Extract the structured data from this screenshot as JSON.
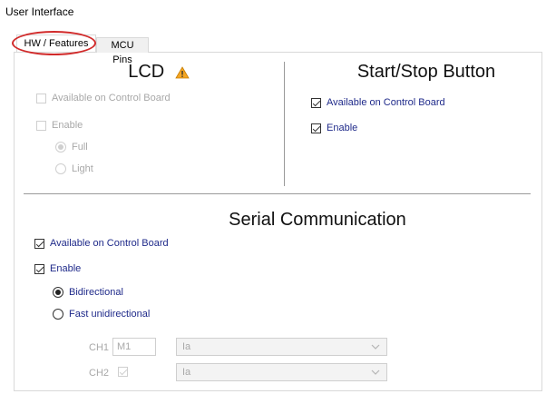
{
  "window": {
    "title": "User Interface"
  },
  "tabs": [
    {
      "label": "HW / Features",
      "active": true
    },
    {
      "label": "MCU Pins",
      "active": false
    }
  ],
  "lcd": {
    "heading": "LCD",
    "warning_icon": "warning-triangle-icon",
    "available_label": "Available on Control Board",
    "available_checked": false,
    "enable_label": "Enable",
    "enable_checked": false,
    "mode_full_label": "Full",
    "mode_light_label": "Light",
    "selected_mode": "Full"
  },
  "start_stop": {
    "heading": "Start/Stop Button",
    "available_label": "Available on Control Board",
    "available_checked": true,
    "enable_label": "Enable",
    "enable_checked": true
  },
  "serial": {
    "heading": "Serial Communication",
    "available_label": "Available on Control Board",
    "available_checked": true,
    "enable_label": "Enable",
    "enable_checked": true,
    "bidirectional_label": "Bidirectional",
    "fast_unidirectional_label": "Fast unidirectional",
    "selected_mode": "Bidirectional",
    "ch1": {
      "label": "CH1",
      "value": "M1",
      "select_value": "Ia"
    },
    "ch2": {
      "label": "CH2",
      "checked": true,
      "select_value": "Ia"
    }
  },
  "colors": {
    "enabled_label": "#1f2a8a",
    "disabled_label": "#a8a8a8",
    "highlight_ring": "#d12a2a",
    "warning": "#f5a623"
  }
}
